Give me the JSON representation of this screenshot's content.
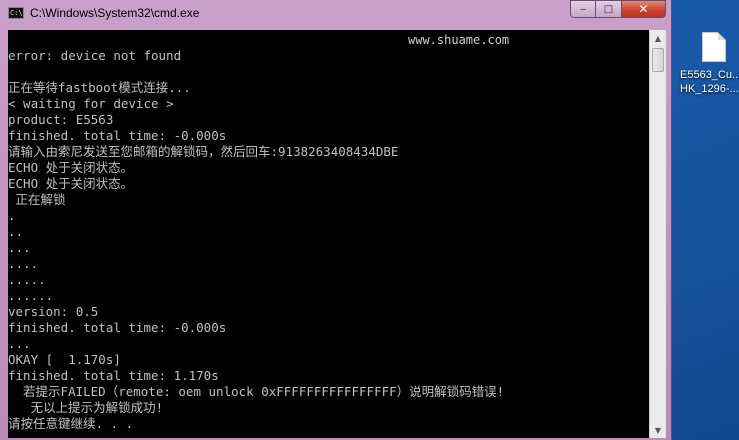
{
  "window": {
    "title": "C:\\Windows\\System32\\cmd.exe",
    "icon_text": "C:\\",
    "buttons": {
      "minimize": "‒",
      "maximize": "□",
      "close": "✕"
    }
  },
  "console": {
    "watermark": "www.shuame.com",
    "lines": [
      "error: device not found",
      "",
      "正在等待fastboot模式连接...",
      "< waiting for device >",
      "product: E5563",
      "finished. total time: -0.000s",
      "请输入由索尼发送至您邮箱的解锁码，然后回车:9138263408434DBE",
      "ECHO 处于关闭状态。",
      "ECHO 处于关闭状态。",
      " 正在解锁",
      ".",
      "..",
      "...",
      "....",
      ".....",
      "......",
      "version: 0.5",
      "finished. total time: -0.000s",
      "...",
      "OKAY [  1.170s]",
      "finished. total time: 1.170s",
      "  若提示FAILED（remote: oem unlock 0xFFFFFFFFFFFFFFFF）说明解锁码错误!",
      "   无以上提示为解锁成功!",
      "请按任意键继续. . ."
    ]
  },
  "desktop": {
    "file_label_line1": "E5563_Cu...",
    "file_label_line2": "HK_1296-..."
  }
}
